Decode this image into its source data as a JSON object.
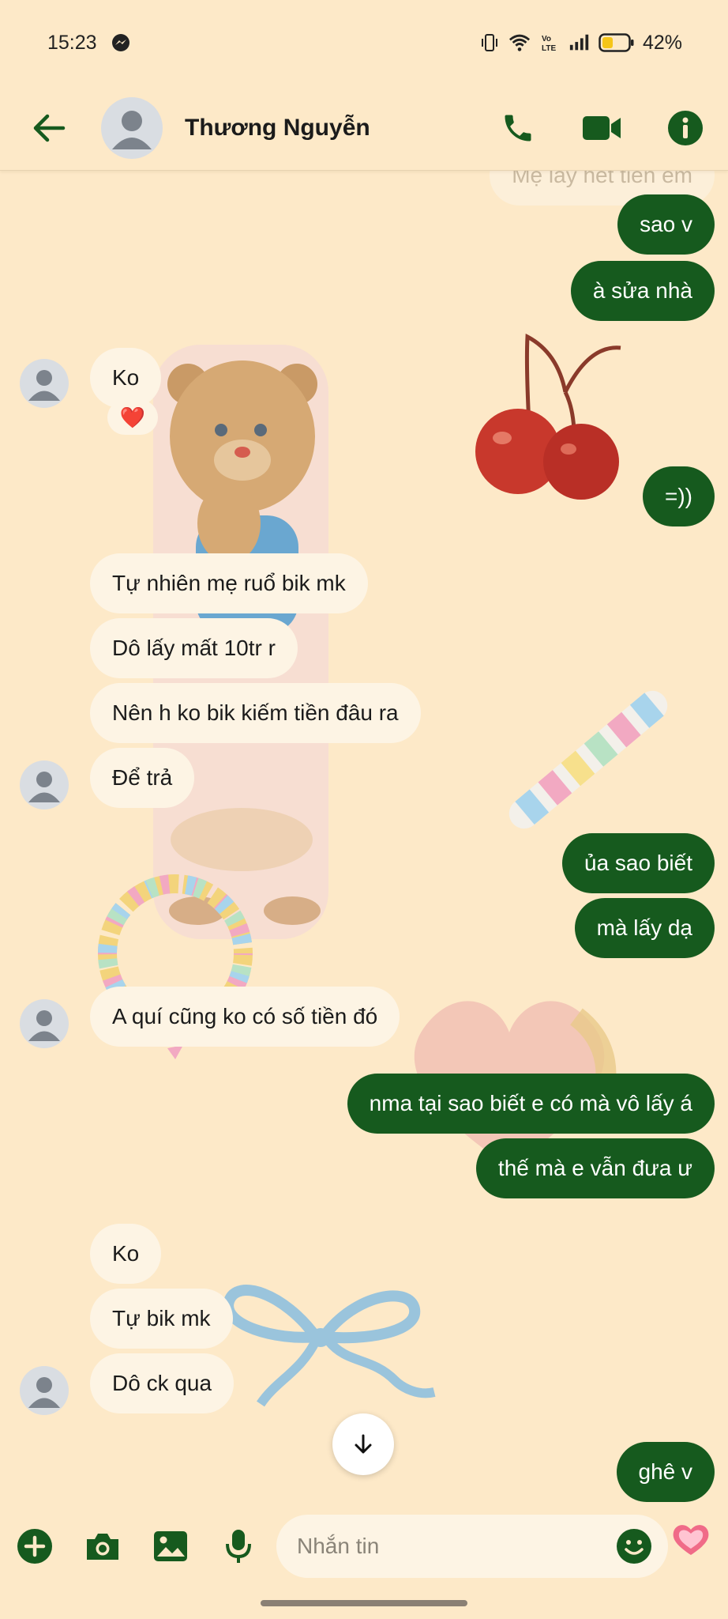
{
  "status_bar": {
    "time": "15:23",
    "battery": "42%",
    "messenger_notification_icon": "messenger-icon",
    "vibrate_icon": "vibrate-icon",
    "wifi_icon": "wifi-icon",
    "volte_icon": "volte-icon",
    "signal_icon": "signal-icon",
    "battery_icon": "battery-icon",
    "battery_level": 0.42,
    "battery_color": "#f5c518"
  },
  "header": {
    "contact_name": "Thương Nguyễn",
    "back_icon": "arrow-left-icon",
    "call_icon": "phone-icon",
    "video_icon": "video-icon",
    "info_icon": "info-icon",
    "accent_color": "#165a1e"
  },
  "messages": [
    {
      "id": "m0",
      "direction": "out",
      "text": "Mẹ lấy hết tiền em",
      "faded": true
    },
    {
      "id": "m1",
      "direction": "out",
      "text": "sao v"
    },
    {
      "id": "m2",
      "direction": "out",
      "text": "à sửa nhà"
    },
    {
      "id": "m3",
      "direction": "in",
      "text": "Ko",
      "reaction": "❤️"
    },
    {
      "id": "m4",
      "direction": "out",
      "text": "=))"
    },
    {
      "id": "m5",
      "direction": "in",
      "text": "Tự nhiên mẹ ruổ bik mk"
    },
    {
      "id": "m6",
      "direction": "in",
      "text": "Dô lấy mất 10tr r"
    },
    {
      "id": "m7",
      "direction": "in",
      "text": "Nên h ko bik kiếm tiền đâu ra"
    },
    {
      "id": "m8",
      "direction": "in",
      "text": "Để trả"
    },
    {
      "id": "m9",
      "direction": "out",
      "text": "ủa sao biết"
    },
    {
      "id": "m10",
      "direction": "out",
      "text": "mà lấy dạ"
    },
    {
      "id": "m11",
      "direction": "in",
      "text": "A quí cũng ko có số tiền đó"
    },
    {
      "id": "m12",
      "direction": "out",
      "text": "nma tại sao biết e có mà vô lấy á"
    },
    {
      "id": "m13",
      "direction": "out",
      "text": "thế mà e vẫn đưa ư"
    },
    {
      "id": "m14",
      "direction": "in",
      "text": "Ko"
    },
    {
      "id": "m15",
      "direction": "in",
      "text": "Tự bik mk"
    },
    {
      "id": "m16",
      "direction": "in",
      "text": "Dô ck qua"
    },
    {
      "id": "m17",
      "direction": "out",
      "text": "ghê v"
    }
  ],
  "scroll_down_icon": "arrow-down-icon",
  "composer": {
    "placeholder": "Nhắn tin",
    "plus_icon": "plus-circle-icon",
    "camera_icon": "camera-icon",
    "gallery_icon": "image-icon",
    "mic_icon": "microphone-icon",
    "emoji_icon": "emoji-icon",
    "like_icon": "heart-icon"
  },
  "theme": {
    "background": "#fde9c8",
    "incoming_bubble": "#fdf4e4",
    "outgoing_bubble": "#165a1e"
  }
}
